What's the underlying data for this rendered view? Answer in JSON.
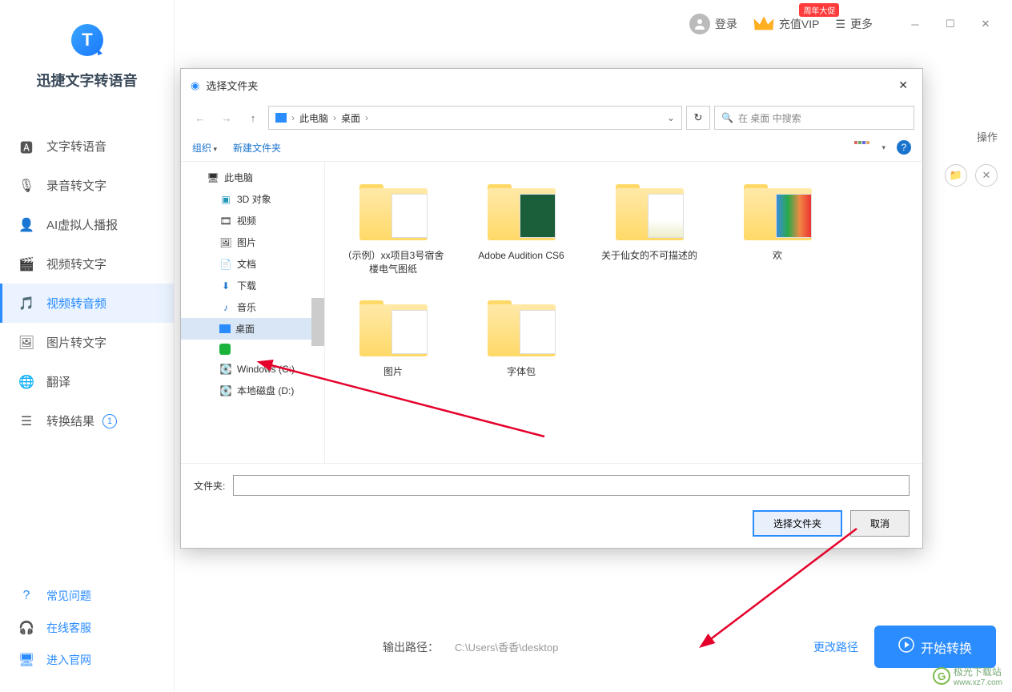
{
  "app": {
    "name": "迅捷文字转语音"
  },
  "topbar": {
    "login": "登录",
    "vip": "充值VIP",
    "vip_badge": "周年大促",
    "more": "更多"
  },
  "sidebar": {
    "items": [
      {
        "label": "文字转语音"
      },
      {
        "label": "录音转文字"
      },
      {
        "label": "AI虚拟人播报"
      },
      {
        "label": "视频转文字"
      },
      {
        "label": "视频转音频"
      },
      {
        "label": "图片转文字"
      },
      {
        "label": "翻译"
      },
      {
        "label": "转换结果",
        "badge": "1"
      }
    ],
    "footer": [
      {
        "label": "常见问题"
      },
      {
        "label": "在线客服"
      },
      {
        "label": "进入官网"
      }
    ]
  },
  "main": {
    "column_header": "操作",
    "output_label": "输出路径：",
    "output_path": "C:\\Users\\香香\\desktop",
    "change_link": "更改路径",
    "start_btn": "开始转换"
  },
  "dialog": {
    "title": "选择文件夹",
    "breadcrumb": [
      "此电脑",
      "桌面"
    ],
    "search_placeholder": "在 桌面 中搜索",
    "toolbar": {
      "organize": "组织",
      "new_folder": "新建文件夹"
    },
    "tree": [
      {
        "label": "此电脑",
        "icon": "pc"
      },
      {
        "label": "3D 对象",
        "icon": "3d"
      },
      {
        "label": "视频",
        "icon": "video"
      },
      {
        "label": "图片",
        "icon": "pictures"
      },
      {
        "label": "文档",
        "icon": "documents"
      },
      {
        "label": "下载",
        "icon": "downloads"
      },
      {
        "label": "音乐",
        "icon": "music"
      },
      {
        "label": "桌面",
        "icon": "desktop",
        "selected": true
      },
      {
        "label": "",
        "icon": "iqiyi"
      },
      {
        "label": "Windows (C:)",
        "icon": "drive"
      },
      {
        "label": "本地磁盘 (D:)",
        "icon": "drive"
      }
    ],
    "folders": [
      {
        "label": "（示例）xx项目3号宿舍楼电气图纸"
      },
      {
        "label": "Adobe Audition CS6"
      },
      {
        "label": "关于仙女的不可描述的"
      },
      {
        "label": "欢"
      },
      {
        "label": "图片"
      },
      {
        "label": "字体包"
      }
    ],
    "footer": {
      "field_label": "文件夹:",
      "select_btn": "选择文件夹",
      "cancel_btn": "取消"
    }
  },
  "watermark": {
    "text": "极光下载站",
    "url": "www.xz7.com"
  }
}
